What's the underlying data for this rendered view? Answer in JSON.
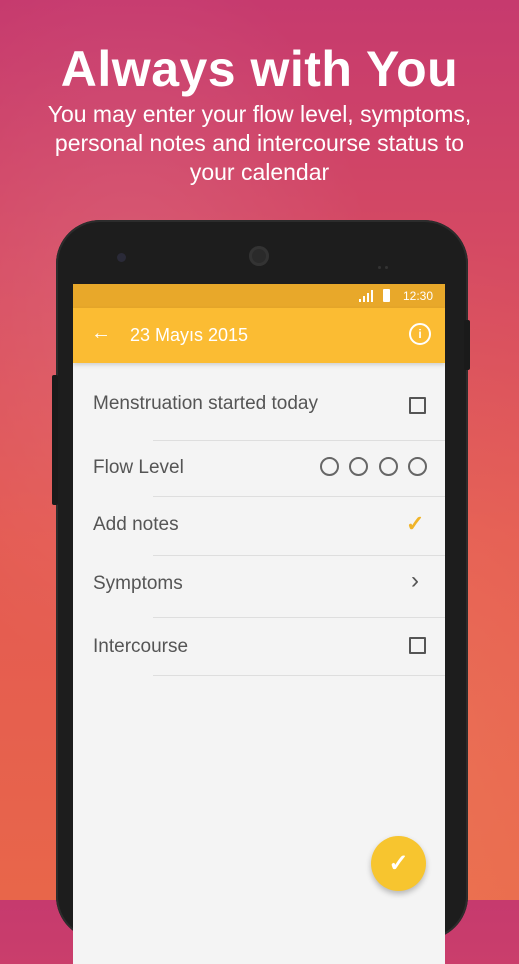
{
  "promo": {
    "headline": "Always with You",
    "subheadline": "You may enter your flow level, symptoms, personal notes and intercourse status to your calendar"
  },
  "status_bar": {
    "time": "12:30"
  },
  "app_bar": {
    "title": "23 Mayıs 2015",
    "back_icon": "arrow-left-icon",
    "info_icon": "info-icon"
  },
  "options": [
    {
      "label": "Menstruation started today",
      "control": "checkbox",
      "checked": false
    },
    {
      "label": "Flow Level",
      "control": "circles",
      "level_count": 4
    },
    {
      "label": "Add notes",
      "control": "check",
      "checked": true
    },
    {
      "label": "Symptoms",
      "control": "chevron"
    },
    {
      "label": "Intercourse",
      "control": "checkbox",
      "checked": false
    }
  ],
  "fab": {
    "icon": "checkmark-icon"
  },
  "colors": {
    "status_bar": "#e8a82a",
    "app_bar": "#fbbc33",
    "accent": "#f0b429",
    "fab": "#f7c52f",
    "background_top": "#c63a6e",
    "background_bottom": "#e8664a"
  }
}
